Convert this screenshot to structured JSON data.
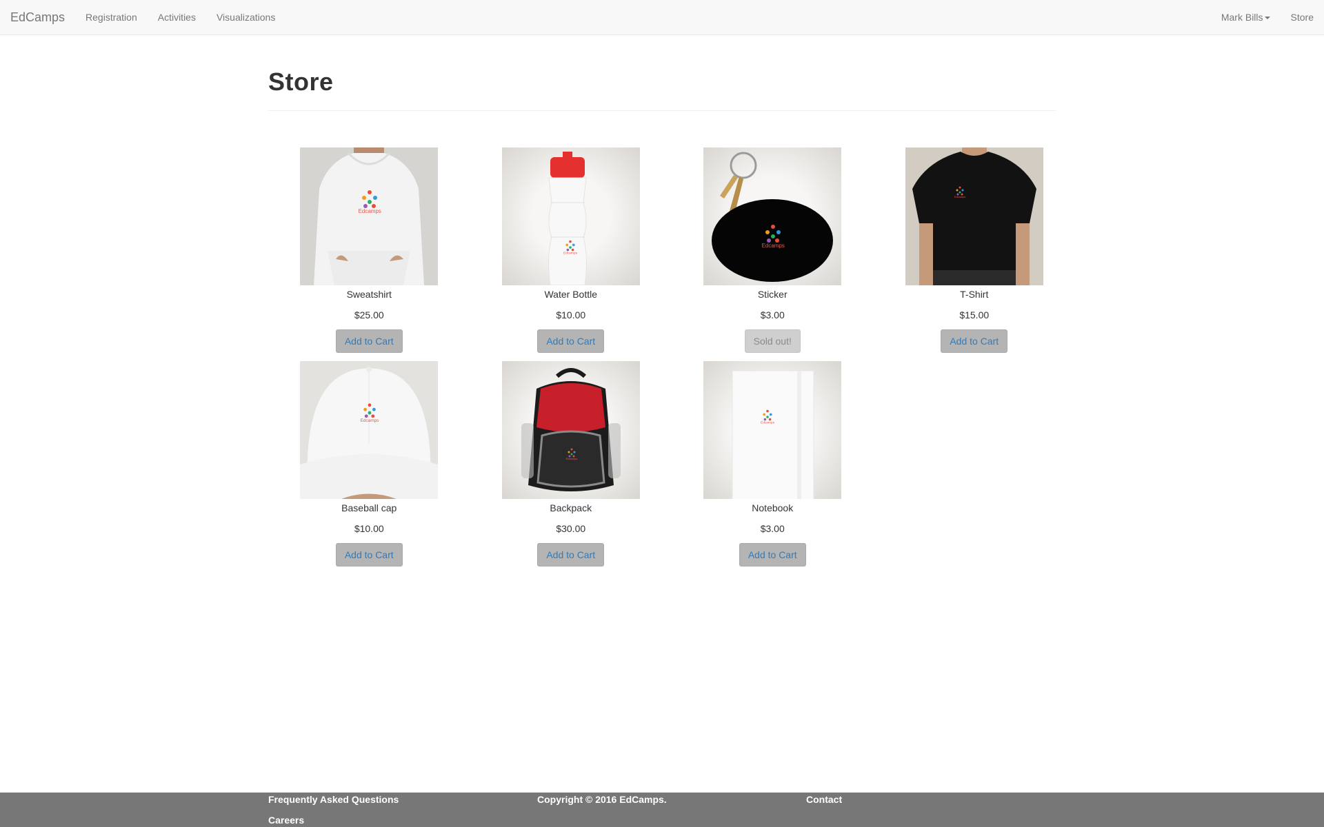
{
  "navbar": {
    "brand": "EdCamps",
    "links": [
      "Registration",
      "Activities",
      "Visualizations"
    ],
    "user": "Mark Bills",
    "store": "Store"
  },
  "page": {
    "title": "Store"
  },
  "products": [
    {
      "name": "Sweatshirt",
      "price": "$25.00",
      "button": "Add to Cart",
      "available": true
    },
    {
      "name": "Water Bottle",
      "price": "$10.00",
      "button": "Add to Cart",
      "available": true
    },
    {
      "name": "Sticker",
      "price": "$3.00",
      "button": "Sold out!",
      "available": false
    },
    {
      "name": "T-Shirt",
      "price": "$15.00",
      "button": "Add to Cart",
      "available": true
    },
    {
      "name": "Baseball cap",
      "price": "$10.00",
      "button": "Add to Cart",
      "available": true
    },
    {
      "name": "Backpack",
      "price": "$30.00",
      "button": "Add to Cart",
      "available": true
    },
    {
      "name": "Notebook",
      "price": "$3.00",
      "button": "Add to Cart",
      "available": true
    }
  ],
  "logo_text": "Edcamps",
  "footer": {
    "faq": "Frequently Asked Questions",
    "careers": "Careers",
    "copyright": "Copyright © 2016 EdCamps.",
    "contact": "Contact"
  },
  "colors": {
    "navbar_bg": "#f8f8f8",
    "link": "#337ab7",
    "button_bg": "#b4b4b4",
    "footer_bg": "#777777"
  }
}
